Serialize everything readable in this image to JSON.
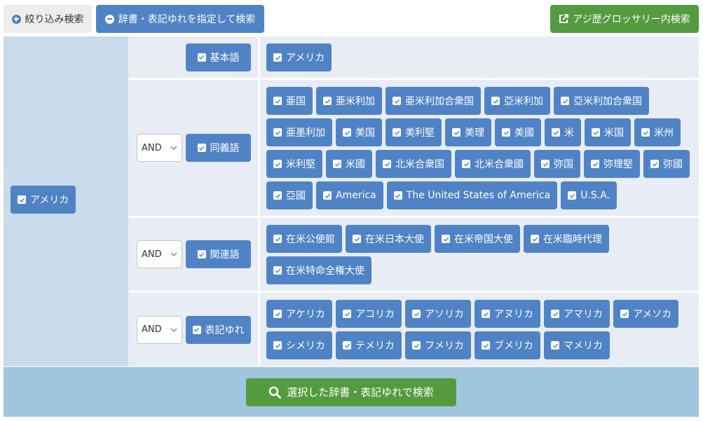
{
  "topbar": {
    "filter_search_label": "絞り込み検索",
    "dict_search_label": "辞書・表記ゆれを指定して検索",
    "glossary_search_label": "アジ歴グロッサリー内検索"
  },
  "root_term": {
    "label": "アメリカ",
    "checked": true
  },
  "rows": [
    {
      "category": "基本語",
      "has_operator": false,
      "terms": [
        "アメリカ"
      ]
    },
    {
      "category": "同義語",
      "has_operator": true,
      "operator": "AND",
      "terms": [
        "亜国",
        "亜米利加",
        "亜米利加合衆国",
        "亞米利加",
        "亞米利加合衆国",
        "亜墨利加",
        "美国",
        "美利堅",
        "美理",
        "美國",
        "米",
        "米国",
        "米州",
        "米利堅",
        "米國",
        "北米合衆国",
        "北米合衆國",
        "弥国",
        "弥理堅",
        "弥國",
        "亞國",
        "America",
        "The United States of America",
        "U.S.A."
      ]
    },
    {
      "category": "関連語",
      "has_operator": true,
      "operator": "AND",
      "terms": [
        "在米公使館",
        "在米日本大使",
        "在米帝国大使",
        "在米臨時代理",
        "在米特命全権大使"
      ]
    },
    {
      "category": "表記ゆれ",
      "has_operator": true,
      "operator": "AND",
      "terms": [
        "アケリカ",
        "アコリカ",
        "アソリカ",
        "アヌリカ",
        "アマリカ",
        "アメソカ",
        "シメリカ",
        "テメリカ",
        "フメリカ",
        "ブメリカ",
        "マメリカ"
      ]
    }
  ],
  "search_button_label": "選択した辞書・表記ゆれで検索",
  "colors": {
    "primary_blue": "#5083c5",
    "green": "#539b3e",
    "left_col_bg": "#c8dbea",
    "row_bg": "#e8edf5",
    "bottom_bg": "#a2c5de"
  }
}
